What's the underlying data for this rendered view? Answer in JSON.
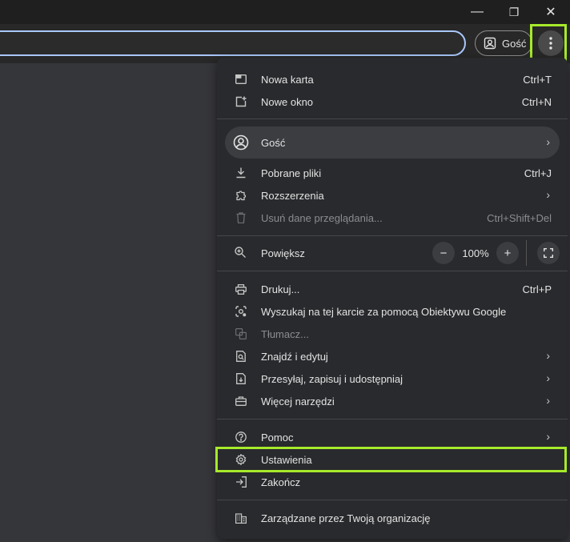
{
  "window": {
    "minimize_glyph": "—",
    "restore_glyph": "❐",
    "close_glyph": "✕"
  },
  "toolbar": {
    "profile_chip_label": "Gość",
    "profile_icon": "person-square-icon",
    "menu_icon": "three-dot-vertical-icon"
  },
  "menu": {
    "items": [
      {
        "label": "Nowa karta",
        "shortcut": "Ctrl+T",
        "icon": "new-tab-icon"
      },
      {
        "label": "Nowe okno",
        "shortcut": "Ctrl+N",
        "icon": "new-window-icon"
      },
      {
        "label": "Gość",
        "icon": "account-circle-icon"
      },
      {
        "label": "Pobrane pliki",
        "shortcut": "Ctrl+J",
        "icon": "download-icon"
      },
      {
        "label": "Rozszerzenia",
        "icon": "extension-icon"
      },
      {
        "label": "Usuń dane przeglądania...",
        "shortcut": "Ctrl+Shift+Del",
        "icon": "trash-icon",
        "disabled": true
      },
      {
        "label": "Powiększ",
        "icon": "zoom-icon"
      },
      {
        "label": "Drukuj...",
        "shortcut": "Ctrl+P",
        "icon": "print-icon"
      },
      {
        "label": "Wyszukaj na tej karcie za pomocą Obiektywu Google",
        "icon": "google-lens-icon"
      },
      {
        "label": "Tłumacz...",
        "icon": "translate-icon",
        "disabled": true
      },
      {
        "label": "Znajdź i edytuj",
        "icon": "find-in-page-icon"
      },
      {
        "label": "Przesyłaj, zapisuj i udostępniaj",
        "icon": "file-save-icon"
      },
      {
        "label": "Więcej narzędzi",
        "icon": "toolbox-icon"
      },
      {
        "label": "Pomoc",
        "icon": "help-icon"
      },
      {
        "label": "Ustawienia",
        "icon": "gear-icon"
      },
      {
        "label": "Zakończ",
        "icon": "exit-icon"
      },
      {
        "label": "Zarządzane przez Twoją organizację",
        "icon": "business-icon"
      }
    ],
    "zoom": {
      "minus": "−",
      "value": "100%",
      "plus": "+"
    },
    "chevron_glyph": "›"
  },
  "colors": {
    "highlight": "#a6ea2a",
    "menu_bg": "#292a2d",
    "omnibox_focus": "#a8c7fa"
  }
}
